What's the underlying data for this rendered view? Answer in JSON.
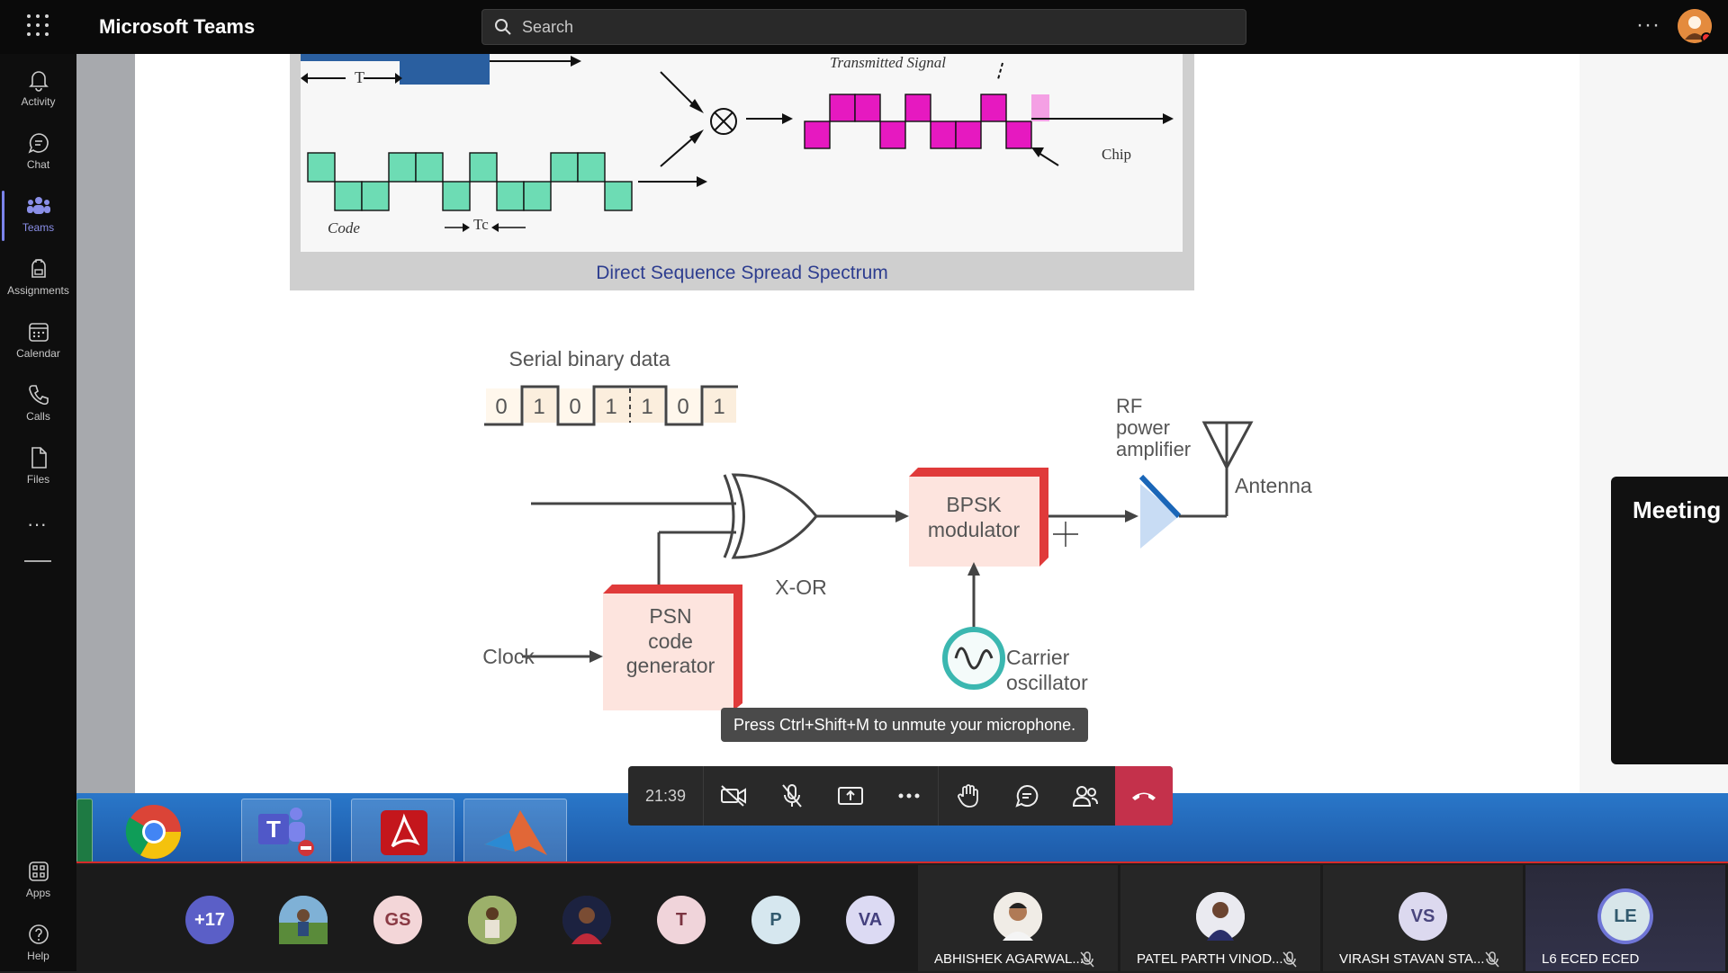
{
  "app": {
    "title": "Microsoft Teams"
  },
  "search": {
    "placeholder": "Search"
  },
  "rail": {
    "items": [
      {
        "label": "Activity",
        "icon": "bell-icon"
      },
      {
        "label": "Chat",
        "icon": "chat-icon"
      },
      {
        "label": "Teams",
        "icon": "teams-icon",
        "active": true
      },
      {
        "label": "Assignments",
        "icon": "assignments-icon"
      },
      {
        "label": "Calendar",
        "icon": "calendar-icon"
      },
      {
        "label": "Calls",
        "icon": "phone-icon"
      },
      {
        "label": "Files",
        "icon": "file-icon"
      }
    ],
    "bottom": [
      {
        "label": "Apps",
        "icon": "apps-icon"
      },
      {
        "label": "Help",
        "icon": "help-icon"
      }
    ]
  },
  "slide": {
    "dsss_caption": "Direct Sequence Spread Spectrum",
    "transmitted_label": "Transmitted Signal",
    "chip_label": "Chip",
    "code_label": "Code",
    "t_label": "T",
    "tc_label": "Tc",
    "serial_label": "Serial binary data",
    "bits": [
      "0",
      "1",
      "0",
      "1",
      "1",
      "0",
      "1"
    ],
    "clock_label": "Clock",
    "psn_label": "PSN\ncode\ngenerator",
    "xor_label": "X-OR",
    "bpsk_label": "BPSK\nmodulator",
    "carrier_label": "Carrier\noscillator",
    "rf_label": "RF\npower\namplifier",
    "antenna_label": "Antenna"
  },
  "meeting_panel": {
    "title": "Meeting"
  },
  "tooltip": {
    "text": "Press Ctrl+Shift+M to unmute your microphone."
  },
  "controls": {
    "time": "21:39"
  },
  "participants": {
    "overflow": "+17",
    "circles": [
      {
        "initials": "GS",
        "bg": "#f3d6d8",
        "fg": "#8a3a44"
      },
      {
        "initials": "T",
        "bg": "#f0d4da",
        "fg": "#7a3340"
      },
      {
        "initials": "P",
        "bg": "#d6e7ef",
        "fg": "#325a6e"
      },
      {
        "initials": "VA",
        "bg": "#dcdaf3",
        "fg": "#44407e"
      }
    ],
    "tiles": [
      {
        "name": "ABHISHEK AGARWAL..."
      },
      {
        "name": "PATEL PARTH VINOD..."
      },
      {
        "name": "VIRASH STAVAN STA...",
        "initials": "VS"
      },
      {
        "name": "L6 ECED ECED",
        "initials": "LE"
      }
    ]
  },
  "colors": {
    "accent": "#7b83eb",
    "hangup": "#c4314b",
    "magenta": "#e619c0",
    "teal": "#40d6a6"
  }
}
